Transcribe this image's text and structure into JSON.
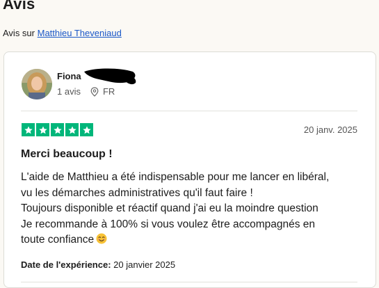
{
  "page": {
    "title": "Avis",
    "subline_prefix": "Avis sur",
    "company_link": "Matthieu Theveniaud"
  },
  "review": {
    "reviewer_name": "Fiona",
    "review_count": "1 avis",
    "country": "FR",
    "rating": 5,
    "rating_max": 5,
    "date": "20 janv. 2025",
    "title": "Merci beaucoup !",
    "body_lines": [
      "L'aide de Matthieu a été indispensable pour me lancer en libéral,",
      "vu les démarches administratives qu'il faut faire !",
      "Toujours disponible et réactif quand j'ai eu la moindre question",
      "Je recommande à 100% si vous voulez être accompagnés en",
      "toute confiance"
    ],
    "experience_label": "Date de l'expérience:",
    "experience_date": "20 janvier 2025"
  },
  "colors": {
    "star_green": "#00b67a",
    "link_blue": "#1a58c8",
    "background": "#fbf9f4"
  },
  "icons": [
    "location-pin-icon",
    "star-icon",
    "smiling-face-emoji-icon"
  ]
}
